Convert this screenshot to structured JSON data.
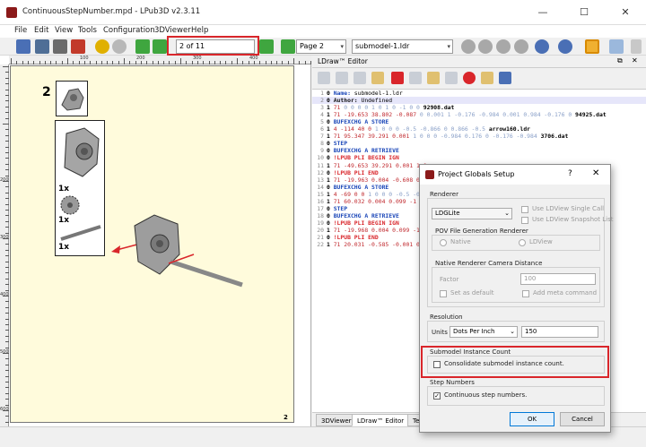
{
  "window": {
    "title": "ContinuousStepNumber.mpd - LPub3D v2.3.11",
    "minimize": "—",
    "maximize": "☐",
    "close": "✕"
  },
  "menu": [
    "File",
    "Edit",
    "View",
    "Tools",
    "Configuration",
    "3DViewer",
    "Help"
  ],
  "toolbar": {
    "step_field": "2 of 11",
    "page_combo": "Page 2",
    "submodel_combo": "submodel-1.ldr"
  },
  "ruler": {
    "h_labels": [
      "100",
      "200",
      "300",
      "400"
    ],
    "v_labels": [
      "200",
      "300",
      "400",
      "500",
      "600"
    ]
  },
  "page": {
    "step_number": "2",
    "qty_labels": [
      "1x",
      "1x",
      "1x"
    ],
    "page_number": "2"
  },
  "editor": {
    "title": "LDraw™ Editor",
    "lines": [
      {
        "n": "1",
        "segs": [
          [
            "0 ",
            "blk"
          ],
          [
            "Name: ",
            "kw"
          ],
          [
            "submodel-1.ldr",
            ""
          ]
        ]
      },
      {
        "n": "2",
        "segs": [
          [
            "0 ",
            "blk"
          ],
          [
            "Author: ",
            "ky"
          ],
          [
            "Undefined",
            ""
          ]
        ]
      },
      {
        "n": "3",
        "segs": [
          [
            "1 ",
            "blk"
          ],
          [
            "71 ",
            "red"
          ],
          [
            "0 0 0 0 1 0 1 0 -1 0 0 ",
            "dim"
          ],
          [
            "92908.dat",
            "blk"
          ]
        ]
      },
      {
        "n": "4",
        "segs": [
          [
            "1 ",
            "blk"
          ],
          [
            "71 ",
            "red"
          ],
          [
            "-19.653 38.802 -0.087 ",
            "red"
          ],
          [
            "0 0.001 1 -0.176 -0.984 0.001 0.984 -0.176 0 ",
            "dim"
          ],
          [
            "94925.dat",
            "blk"
          ]
        ]
      },
      {
        "n": "5",
        "segs": [
          [
            "0 ",
            "blk"
          ],
          [
            "BUFEXCHG A STORE",
            "kw"
          ]
        ]
      },
      {
        "n": "6",
        "segs": [
          [
            "1 ",
            "blk"
          ],
          [
            "4 ",
            "red"
          ],
          [
            "-114 40 0 ",
            "red"
          ],
          [
            "1 0 0 0 -0.5 -0.866 0 0.866 -0.5 ",
            "dim"
          ],
          [
            "arrow160.ldr",
            "blk"
          ]
        ]
      },
      {
        "n": "7",
        "segs": [
          [
            "1 ",
            "blk"
          ],
          [
            "71 ",
            "red"
          ],
          [
            "95.347 39.291 0.001 ",
            "red"
          ],
          [
            "1 0 0 0 -0.984 0.176 0 -0.176 -0.984 ",
            "dim"
          ],
          [
            "3706.dat",
            "blk"
          ]
        ]
      },
      {
        "n": "8",
        "segs": [
          [
            "0 ",
            "blk"
          ],
          [
            "STEP",
            "kw"
          ]
        ]
      },
      {
        "n": "9",
        "segs": [
          [
            "0 ",
            "blk"
          ],
          [
            "BUFEXCHG A RETRIEVE",
            "kw"
          ]
        ]
      },
      {
        "n": "10",
        "segs": [
          [
            "0 ",
            "blk"
          ],
          [
            "!LPUB ",
            "lr"
          ],
          [
            "PLI BEGIN IGN",
            "lr"
          ]
        ]
      },
      {
        "n": "11",
        "segs": [
          [
            "1 ",
            "blk"
          ],
          [
            "71 ",
            "red"
          ],
          [
            "-49.653 39.291 0.001 1 0 ",
            "red"
          ]
        ]
      },
      {
        "n": "12",
        "segs": [
          [
            "0 ",
            "blk"
          ],
          [
            "!LPUB ",
            "lr"
          ],
          [
            "PLI END",
            "lr"
          ]
        ]
      },
      {
        "n": "13",
        "segs": [
          [
            "1 ",
            "blk"
          ],
          [
            "71 ",
            "red"
          ],
          [
            "-19.963 0.004 -0.608 0 0",
            "red"
          ]
        ]
      },
      {
        "n": "14",
        "segs": [
          [
            "0 ",
            "blk"
          ],
          [
            "BUFEXCHG A STORE",
            "kw"
          ]
        ]
      },
      {
        "n": "15",
        "segs": [
          [
            "1 ",
            "blk"
          ],
          [
            "4 ",
            "red"
          ],
          [
            "-69 0 0 ",
            "red"
          ],
          [
            "1 0 0 0 -0.5 -0.866 0",
            "dim"
          ]
        ]
      },
      {
        "n": "16",
        "segs": [
          [
            "1 ",
            "blk"
          ],
          [
            "71 ",
            "red"
          ],
          [
            "60.032 0.004 0.099 -1 0 0",
            "red"
          ]
        ]
      },
      {
        "n": "17",
        "segs": [
          [
            "0 ",
            "blk"
          ],
          [
            "STEP",
            "kw"
          ]
        ]
      },
      {
        "n": "18",
        "segs": [
          [
            "0 ",
            "blk"
          ],
          [
            "BUFEXCHG A RETRIEVE",
            "kw"
          ]
        ]
      },
      {
        "n": "19",
        "segs": [
          [
            "0 ",
            "blk"
          ],
          [
            "!LPUB ",
            "lr"
          ],
          [
            "PLI BEGIN IGN",
            "lr"
          ]
        ]
      },
      {
        "n": "20",
        "segs": [
          [
            "1 ",
            "blk"
          ],
          [
            "71 ",
            "red"
          ],
          [
            "-19.968 0.004 0.099 -1 0",
            "red"
          ]
        ]
      },
      {
        "n": "21",
        "segs": [
          [
            "0 ",
            "blk"
          ],
          [
            "!LPUB ",
            "lr"
          ],
          [
            "PLI END",
            "lr"
          ]
        ]
      },
      {
        "n": "22",
        "segs": [
          [
            "1 ",
            "blk"
          ],
          [
            "71 ",
            "red"
          ],
          [
            "20.031 -0.585 -0.001 0 -0",
            "red"
          ]
        ]
      }
    ],
    "tabs": [
      "3DViewer",
      "LDraw™ Editor",
      "Te"
    ]
  },
  "dialog": {
    "title": "Project Globals Setup",
    "help": "?",
    "close": "✕",
    "renderer_label": "Renderer",
    "renderer_value": "LDGLite",
    "ldview_single_call": "Use LDView Single Call",
    "ldview_snapshot_list": "Use LDView Snapshot List",
    "pov_label": "POV File Generation Renderer",
    "native": "Native",
    "ldview": "LDView",
    "cam_label": "Native Renderer Camera Distance",
    "factor": "Factor",
    "factor_value": "100",
    "set_default": "Set as default",
    "add_meta": "Add meta command",
    "resolution_label": "Resolution",
    "units": "Units",
    "units_value": "Dots Per Inch",
    "res_value": "150",
    "submodel_label": "Submodel Instance Count",
    "consolidate": "Consolidate submodel instance count.",
    "step_numbers_label": "Step Numbers",
    "continuous": "Continuous step numbers.",
    "ok": "OK",
    "cancel": "Cancel"
  },
  "colors": {
    "accent": "#d9262b",
    "page": "#fffbdc",
    "keyword": "#1a46b8"
  }
}
